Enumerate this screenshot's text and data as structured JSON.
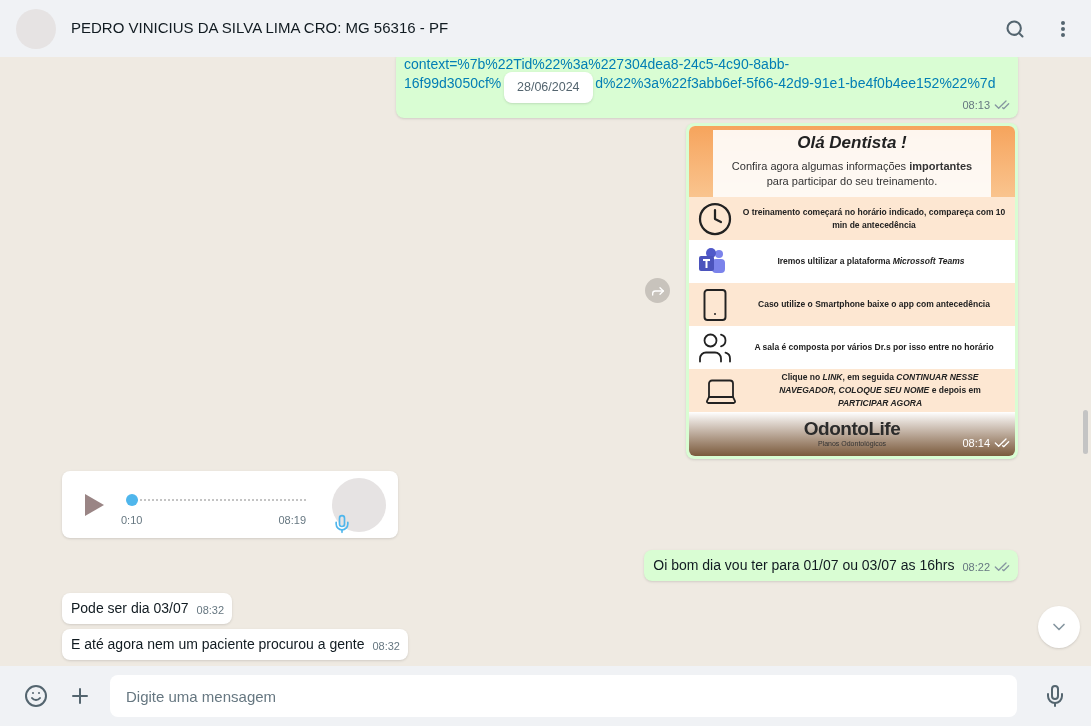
{
  "header": {
    "title": "PEDRO VINICIUS DA SILVA LIMA CRO: MG 56316 - PF"
  },
  "date_pill": "28/06/2024",
  "messages": [
    {
      "kind": "link",
      "outgoing": true,
      "lines": [
        "context=%7b%22Tid%22%3a%227304dea8-24c5-4c90-8abb-"
      ],
      "covered_line": [
        "16f99d3050cf%",
        "d%22%3a%22f3abb6ef-5f66-42d9-91e1-be4f0b4ee152%22%7d"
      ],
      "time": "08:13",
      "read": false
    },
    {
      "kind": "image",
      "outgoing": true,
      "time": "08:14",
      "read": false,
      "flyer": {
        "title": "Olá Dentista !",
        "intro": "Confira agora algumas informações **importantes** para participar do seu treinamento.",
        "items": [
          {
            "kind": "clock",
            "text": "O treinamento começará no horário indicado, compareça com 10 min de antecedência"
          },
          {
            "kind": "teams",
            "text": "Iremos ultilizar a plataforma *Microssoft Teams*"
          },
          {
            "kind": "phone",
            "text": "Caso utilize o Smartphone baixe o app com antecedência"
          },
          {
            "kind": "people",
            "text": "A sala é composta por vários Dr.s por isso entre no horário"
          },
          {
            "kind": "laptop",
            "text": "Clique no *LINK*, em seguida *CONTINUAR NESSE NAVEGADOR, COLOQUE SEU NOME* e depois em *PARTICIPAR AGORA*"
          }
        ],
        "brand": "OdontoLife",
        "brand_sub": "Planos Odontológicos"
      }
    },
    {
      "kind": "voice",
      "outgoing": false,
      "duration": "0:10",
      "time": "08:19",
      "level": 0
    },
    {
      "kind": "text",
      "outgoing": true,
      "text": "Oi bom dia vou ter para 01/07 ou 03/07 as 16hrs",
      "time": "08:22",
      "read": false
    },
    {
      "kind": "text",
      "outgoing": false,
      "text": "Pode ser dia 03/07",
      "time": "08:32"
    },
    {
      "kind": "text",
      "outgoing": false,
      "text": "E até agora nem um paciente procurou a gente",
      "time": "08:32"
    }
  ],
  "composer": {
    "placeholder": "Digite uma mensagem"
  }
}
